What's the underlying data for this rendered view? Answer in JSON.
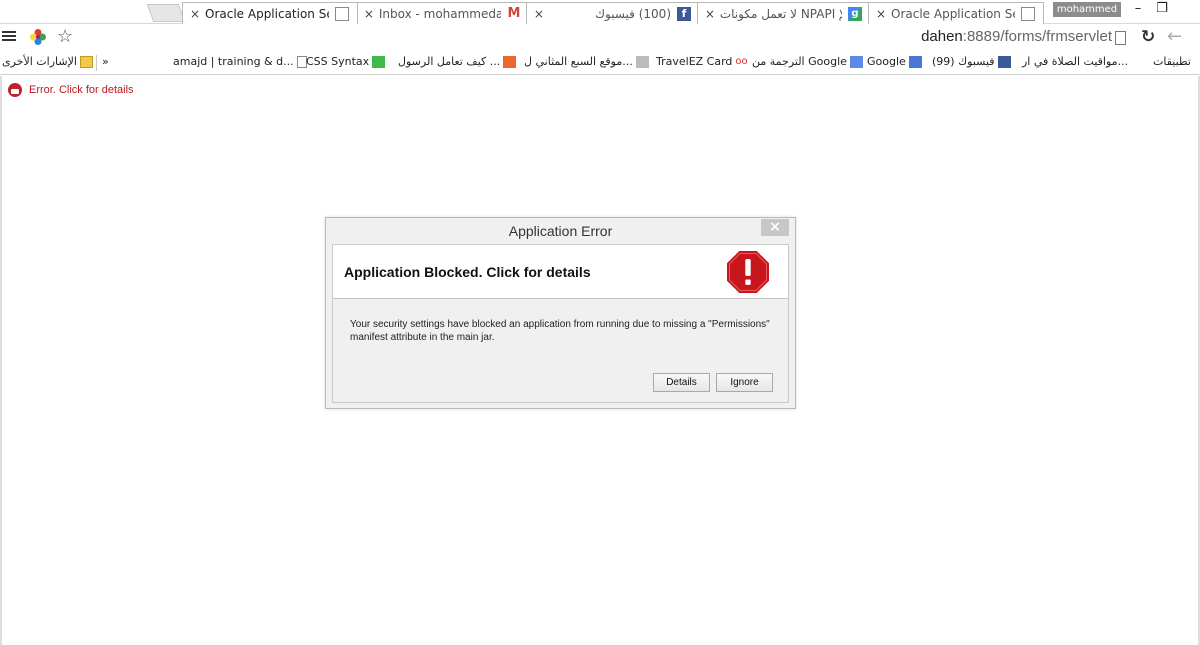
{
  "browser": {
    "tabs": [
      {
        "title": "Oracle Application Server",
        "close": "×",
        "icon": "page-icon",
        "active": true
      },
      {
        "title": "Inbox - mohammedasum",
        "close": "×",
        "icon": "gmail-icon"
      },
      {
        "title": "(100) فيسبوك",
        "close": "×",
        "icon": "facebook-icon"
      },
      {
        "title": "لا تعمل مكونات NPAPI الإ",
        "close": "×",
        "icon": "google-icon"
      },
      {
        "title": "Oracle Application Server",
        "close": "×",
        "icon": "page-icon"
      }
    ],
    "user": "mohammed",
    "window_controls": {
      "minimize": "–",
      "restore": "❐"
    },
    "url_host": "dahen",
    "url_rest": ":8889/forms/frmservlet",
    "menu_icon": "hamburger-menu-icon",
    "star_icon": "☆",
    "reload_icon": "↻",
    "back_icon": "←"
  },
  "bookmarks": {
    "chevron": "»",
    "other_bookmarks": "الإشارات الأخرى",
    "items": [
      {
        "label": "amajd | training & d...",
        "icon": "page-icon"
      },
      {
        "label": "CSS Syntax",
        "icon": "w3-icon"
      },
      {
        "label": "كيف تعامل الرسول ...",
        "icon": "orange-icon"
      },
      {
        "label": "موقع السبع المثاني ل...",
        "icon": "image-icon"
      },
      {
        "label": "TravelEZ Card",
        "icon": "eyes-icon"
      },
      {
        "label": "الترجمة من Google",
        "icon": "translate-icon"
      },
      {
        "label": "Google",
        "icon": "google-plus-icon"
      },
      {
        "label": "(99) فيسبوك",
        "icon": "facebook-icon"
      },
      {
        "label": "مواقيت الصلاة في ار...",
        "icon": "none"
      },
      {
        "label": "تطبيقات",
        "icon": "apps-icon"
      }
    ]
  },
  "page": {
    "error_link": "Error. Click for details"
  },
  "dialog": {
    "title": "Application Error",
    "close": "×",
    "heading": "Application Blocked. Click for details",
    "message": "Your security settings have blocked an application from running due to missing a \"Permissions\" manifest attribute in the main jar.",
    "buttons": {
      "details": "Details",
      "ignore": "Ignore"
    },
    "icon": "stop-error-icon",
    "colors": {
      "stop": "#c8161d",
      "error_text": "#c0171f"
    }
  }
}
